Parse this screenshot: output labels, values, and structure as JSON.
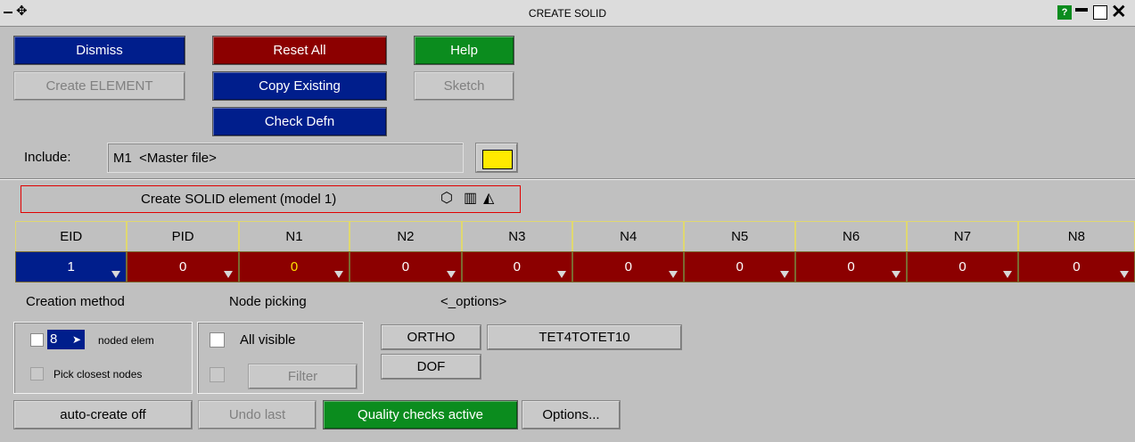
{
  "window": {
    "title": "CREATE SOLID"
  },
  "toolbar": {
    "dismiss": "Dismiss",
    "reset_all": "Reset All",
    "help": "Help",
    "create_element": "Create ELEMENT",
    "copy_existing": "Copy Existing",
    "sketch": "Sketch",
    "check_defn": "Check Defn"
  },
  "include": {
    "label": "Include:",
    "value": "M1  <Master file>"
  },
  "panel_title": "Create SOLID element (model 1)",
  "table": {
    "headers": [
      "EID",
      "PID",
      "N1",
      "N2",
      "N3",
      "N4",
      "N5",
      "N6",
      "N7",
      "N8"
    ],
    "values": [
      "1",
      "0",
      "0",
      "0",
      "0",
      "0",
      "0",
      "0",
      "0",
      "0"
    ]
  },
  "sections": {
    "creation_method": "Creation method",
    "node_picking": "Node picking",
    "options": "<_options>"
  },
  "creation": {
    "nodes_value": "8",
    "noded_elem": "noded elem",
    "pick_closest": "Pick closest nodes"
  },
  "picking": {
    "all_visible": "All visible",
    "filter": "Filter"
  },
  "option_buttons": {
    "ortho": "ORTHO",
    "tet": "TET4TOTET10",
    "dof": "DOF"
  },
  "bottom": {
    "auto_create": "auto-create off",
    "undo_last": "Undo last",
    "quality": "Quality checks active",
    "options": "Options..."
  },
  "colors": {
    "blue": "#001e8c",
    "red": "#8c0000",
    "green": "#0b8c1e",
    "yellow_text": "#ffe000"
  }
}
